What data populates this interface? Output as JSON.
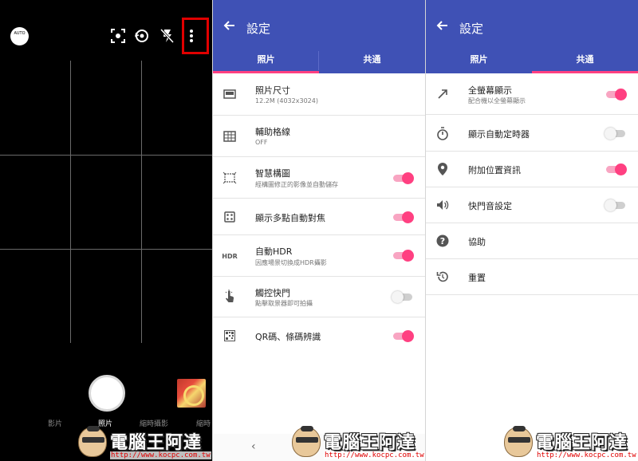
{
  "camera": {
    "auto_badge": "AUTO",
    "modes": [
      "影片",
      "照片",
      "縮時攝影"
    ],
    "active_mode": "照片",
    "partial_mode": "縮時"
  },
  "panel1": {
    "title": "設定",
    "tabs": [
      "照片",
      "共通"
    ],
    "active_tab": 0,
    "rows": [
      {
        "title": "照片尺寸",
        "subtitle": "12.2M (4032x3024)",
        "icon": "photo-size-icon"
      },
      {
        "title": "輔助格線",
        "subtitle": "OFF",
        "icon": "grid-icon"
      },
      {
        "title": "智慧構圖",
        "subtitle": "經構圖修正的影像並自動儲存",
        "icon": "smart-composition-icon",
        "toggle": true
      },
      {
        "title": "顯示多點自動對焦",
        "icon": "multi-af-icon",
        "toggle": true
      },
      {
        "title": "自動HDR",
        "subtitle": "因應場景切換成HDR攝影",
        "icon": "hdr-icon",
        "icon_text": "HDR",
        "toggle": true
      },
      {
        "title": "觸控快門",
        "subtitle": "點擊取景器即可拍攝",
        "icon": "touch-shutter-icon",
        "toggle": false
      },
      {
        "title": "QR碼、條碼辨識",
        "icon": "qr-code-icon",
        "toggle": true
      }
    ]
  },
  "panel2": {
    "title": "設定",
    "tabs": [
      "照片",
      "共通"
    ],
    "active_tab": 1,
    "rows": [
      {
        "title": "全螢幕顯示",
        "subtitle": "配合機以全螢幕顯示",
        "icon": "fullscreen-icon",
        "toggle": true
      },
      {
        "title": "顯示自動定時器",
        "icon": "timer-icon",
        "toggle": false
      },
      {
        "title": "附加位置資訊",
        "icon": "location-icon",
        "toggle": true
      },
      {
        "title": "快門音設定",
        "icon": "volume-icon",
        "toggle": false
      },
      {
        "title": "協助",
        "icon": "help-icon"
      },
      {
        "title": "重置",
        "icon": "reset-icon"
      }
    ]
  },
  "watermark": {
    "text": "電腦王阿達",
    "url": "http://www.kocpc.com.tw"
  },
  "colors": {
    "appbar": "#3f51b5",
    "accent": "#ff4081",
    "highlight": "#e00000"
  }
}
